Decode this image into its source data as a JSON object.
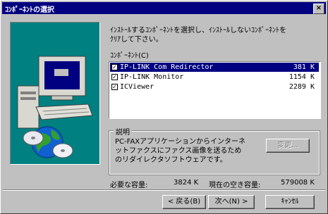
{
  "window": {
    "title": "ｺﾝﾎﾟｰﾈﾝﾄの選択",
    "close_glyph": "×"
  },
  "instructions": "ｲﾝｽﾄｰﾙするｺﾝﾎﾟｰﾈﾝﾄを選択し、ｲﾝｽﾄｰﾙしないｺﾝﾎﾟｰﾈﾝﾄを\nｸﾘｱして下さい。",
  "components_label": "ｺﾝﾎﾟｰﾈﾝﾄ(C)",
  "components": [
    {
      "name": "IP-LINK Com Redirector",
      "size": "381 K",
      "checked": true,
      "selected": true
    },
    {
      "name": "IP-LINK Monitor",
      "size": "1154 K",
      "checked": true,
      "selected": false
    },
    {
      "name": "ICViewer",
      "size": "2289 K",
      "checked": true,
      "selected": false
    }
  ],
  "description": {
    "title": "説明",
    "text": "PC-FAXアプリケーションからインターネ\nットファクスにファクス画像を送るため\nのリダイレクタソフトウェアです。",
    "change_button": "変更..."
  },
  "space": {
    "required_label": "必要な容量:",
    "required_value": "3824 K",
    "free_label": "現在の空き容量:",
    "free_value": "579008 K"
  },
  "buttons": {
    "back": "< 戻る(B)",
    "next": "次へ(N) >",
    "cancel": "ｷｬﾝｾﾙ"
  },
  "colors": {
    "titlebar": "#000080",
    "art_bg": "#008080",
    "selection": "#000080"
  }
}
